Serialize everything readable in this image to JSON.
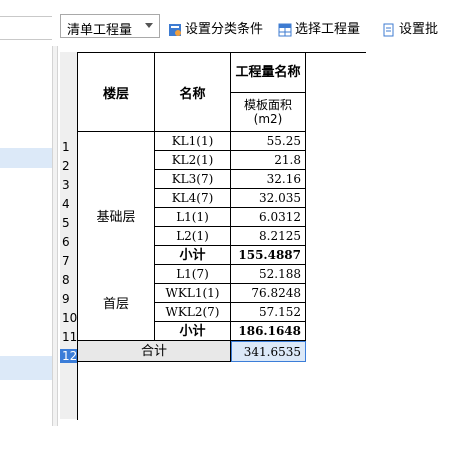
{
  "toolbar": {
    "dropdown_label": "清单工程量",
    "set_category_label": "设置分类条件",
    "select_quantity_label": "选择工程量",
    "set_label": "设置批"
  },
  "table": {
    "header": {
      "floor": "楼层",
      "name": "名称",
      "quantity_title": "工程量名称",
      "quantity_sub": "模板面积(m2)"
    },
    "row_numbers": [
      "1",
      "2",
      "3",
      "4",
      "5",
      "6",
      "7",
      "8",
      "9",
      "10",
      "11",
      "12"
    ],
    "groups": [
      {
        "floor": "基础层",
        "rows": [
          {
            "name": "KL1(1)",
            "value": "55.25"
          },
          {
            "name": "KL2(1)",
            "value": "21.8"
          },
          {
            "name": "KL3(7)",
            "value": "32.16"
          },
          {
            "name": "KL4(7)",
            "value": "32.035"
          },
          {
            "name": "L1(1)",
            "value": "6.0312"
          },
          {
            "name": "L2(1)",
            "value": "8.2125"
          }
        ],
        "subtotal_label": "小计",
        "subtotal_value": "155.4887"
      },
      {
        "floor": "首层",
        "rows": [
          {
            "name": "L1(7)",
            "value": "52.188"
          },
          {
            "name": "WKL1(1)",
            "value": "76.8248"
          },
          {
            "name": "WKL2(7)",
            "value": "57.152"
          }
        ],
        "subtotal_label": "小计",
        "subtotal_value": "186.1648"
      }
    ],
    "total_label": "合计",
    "total_value": "341.6535"
  },
  "colors": {
    "selected_row_header": "#3b7dd8",
    "highlight": "#dce9f8"
  }
}
